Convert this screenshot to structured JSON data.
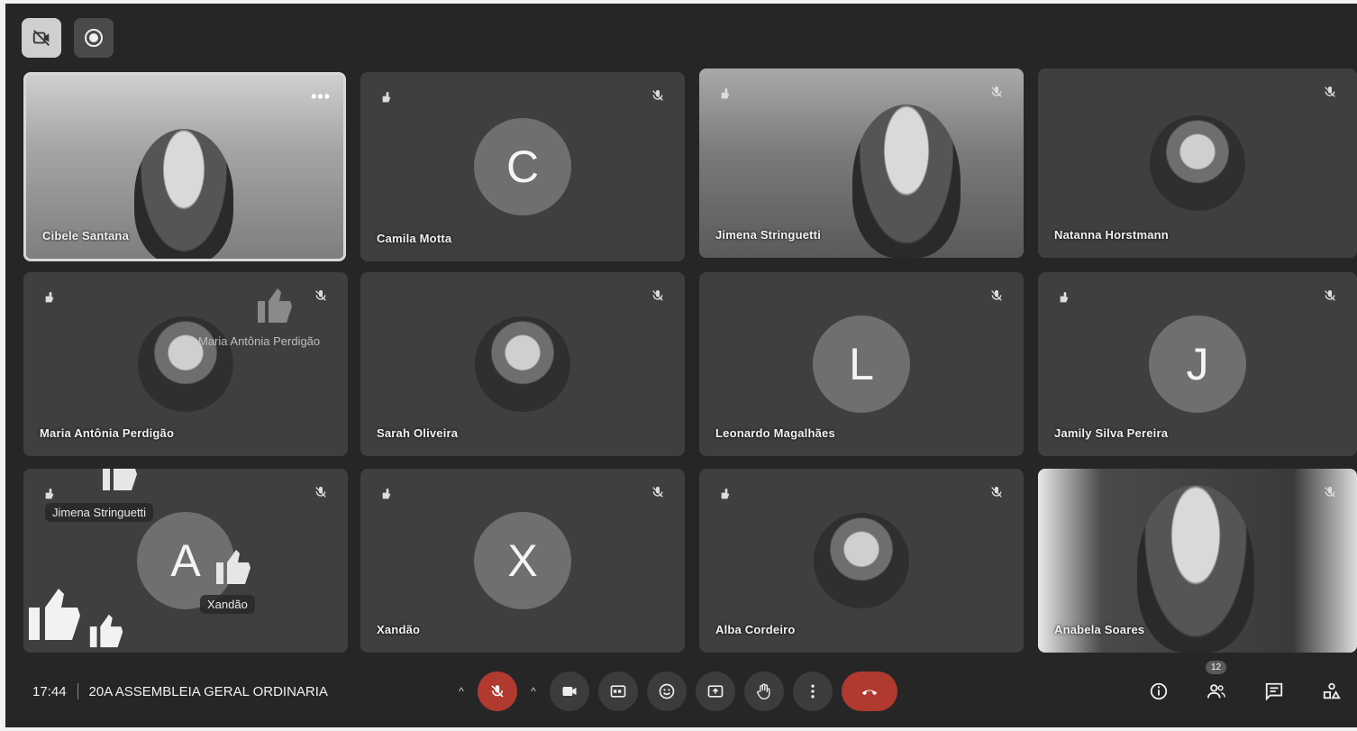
{
  "meeting": {
    "time": "17:44",
    "title": "20A ASSEMBLEIA GERAL ORDINARIA"
  },
  "participants_count": "12",
  "tiles": [
    {
      "name": "Cibele Santana",
      "kind": "video-self"
    },
    {
      "name": "Camila Motta",
      "kind": "initial",
      "initial": "C"
    },
    {
      "name": "Jimena Stringuetti",
      "kind": "video"
    },
    {
      "name": "Natanna Horstmann",
      "kind": "photo"
    },
    {
      "name": "Maria Antônia Perdigão",
      "kind": "photo"
    },
    {
      "name": "Sarah Oliveira",
      "kind": "photo"
    },
    {
      "name": "Leonardo Magalhães",
      "kind": "initial",
      "initial": "L"
    },
    {
      "name": "Jamily Silva Pereira",
      "kind": "initial",
      "initial": "J"
    },
    {
      "name": "",
      "kind": "initial",
      "initial": "A"
    },
    {
      "name": "Xandão",
      "kind": "initial",
      "initial": "X"
    },
    {
      "name": "Alba Cordeiro",
      "kind": "photo"
    },
    {
      "name": "Anabela Soares",
      "kind": "video"
    }
  ],
  "reactions": {
    "maria_label": "Maria Antônia Perdigão",
    "jimena_label": "Jimena Stringuetti",
    "xandao_label": "Xandão"
  },
  "icons": {
    "camera_off": "camera-off-icon",
    "record": "record-icon",
    "mic_off": "mic-off-icon",
    "hand": "raised-hand-icon"
  }
}
